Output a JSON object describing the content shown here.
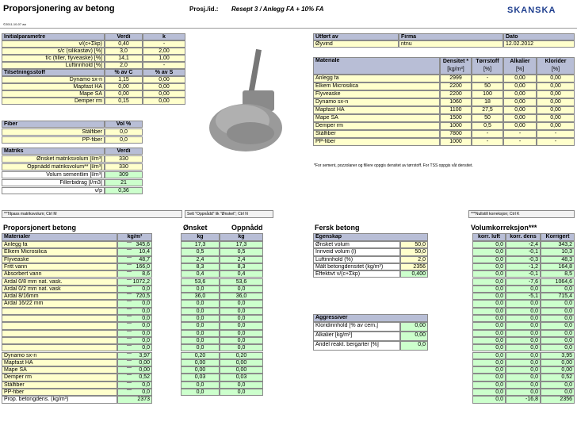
{
  "header": {
    "title": "Proporsjonering av betong",
    "proj_label": "Prosj./id.:",
    "proj_value": "Resept 3 / Anlegg FA + 10% FA",
    "brand": "SKANSKA",
    "copyright": "©2011-10-07 aa"
  },
  "initial": {
    "title": "Initialparametre",
    "col1": "Verdi",
    "col2": "k",
    "rows": [
      {
        "label": "v/(c+Σkp)",
        "val": "0,40",
        "k": "-"
      },
      {
        "label": "s/c (silikastøv) [%]",
        "val": "3,0",
        "k": "2,00"
      },
      {
        "label": "f/c (filler, flyveaske) [%]",
        "val": "14,1",
        "k": "1,00"
      },
      {
        "label": "Luftinnhold [%]",
        "val": "2,0",
        "k": "-"
      }
    ]
  },
  "additive": {
    "title": "Tilsetningsstoff",
    "col1": "% av C",
    "col2": "% av S",
    "rows": [
      {
        "label": "Dynamo sx-n",
        "c": "1,15",
        "s": "0,00"
      },
      {
        "label": "Mapfast HA",
        "c": "0,00",
        "s": "0,00"
      },
      {
        "label": "Mape SA",
        "c": "0,00",
        "s": "0,00"
      },
      {
        "label": "Demper rm",
        "c": "0,15",
        "s": "0,00"
      }
    ]
  },
  "fiber": {
    "title": "Fiber",
    "col1": "Vol %",
    "rows": [
      {
        "label": "Stålfiber",
        "val": "0,0"
      },
      {
        "label": "PP-fiber",
        "val": "0,0"
      }
    ]
  },
  "matrix": {
    "title": "Matriks",
    "col1": "Verdi",
    "rows": [
      {
        "label": "Ønsket matriksvolum [l/m³]",
        "val": "330"
      },
      {
        "label": "Oppnådd matriksvolum** [l/m³]",
        "val": "330"
      },
      {
        "label": "Volum sementlim [l/m³]",
        "val": "309"
      },
      {
        "label": "Fillerbidrag [l/m3]",
        "val": "21"
      },
      {
        "label": "v/p",
        "val": "0,36"
      }
    ]
  },
  "meta": {
    "h_by": "Utført av",
    "h_firm": "Firma",
    "h_date": "Dato",
    "by": "Øyvind",
    "firm": "ntnu",
    "date": "12.02.2012"
  },
  "materials": {
    "title": "Materiale",
    "h_density": "Densitet *",
    "h_density_unit": "[kg/m³]",
    "h_dry": "Tørrstoff",
    "h_dry_unit": "[%]",
    "h_alk": "Alkalier",
    "h_alk_unit": "[%]",
    "h_chl": "Klorider",
    "h_chl_unit": "[%]",
    "rows": [
      {
        "name": "Anlegg fa",
        "d": "2999",
        "dry": "-",
        "alk": "0,00",
        "chl": "0,00"
      },
      {
        "name": "Elkem Microsilica",
        "d": "2200",
        "dry": "50",
        "alk": "0,00",
        "chl": "0,00"
      },
      {
        "name": "Flyveaske",
        "d": "2200",
        "dry": "100",
        "alk": "0,00",
        "chl": "0,00"
      },
      {
        "name": "Dynamo sx-n",
        "d": "1060",
        "dry": "18",
        "alk": "0,00",
        "chl": "0,00"
      },
      {
        "name": "Mapfast HA",
        "d": "1100",
        "dry": "27,5",
        "alk": "0,00",
        "chl": "0,00"
      },
      {
        "name": "Mape SA",
        "d": "1500",
        "dry": "50",
        "alk": "0,00",
        "chl": "0,00"
      },
      {
        "name": "Demper rm",
        "d": "1000",
        "dry": "0,5",
        "alk": "0,00",
        "chl": "0,00"
      },
      {
        "name": "Stålfiber",
        "d": "7800",
        "dry": "-",
        "alk": "-",
        "chl": "-"
      },
      {
        "name": "PP-fiber",
        "d": "1000",
        "dry": "-",
        "alk": "-",
        "chl": "-"
      }
    ],
    "footnote": "*For sement, pozzolaner og fillere oppgis densitet av tørrstoff.   For TSS oppgis våt densitet."
  },
  "notes": {
    "left": "**Tilpass matriksvolum; Ctrl M",
    "mid": "Sett \"Oppnådd\" lik \"Ønsket\"; Ctrl N",
    "right": "***Nullstill korreksjon; Ctrl K"
  },
  "proportion": {
    "title": "Proporsjonert betong",
    "h_mat": "Materialer",
    "h_kg": "kg/m³",
    "h_wish": "Ønsket",
    "h_got": "Oppnådd",
    "unit_kg": "kg",
    "rows": [
      {
        "name": "Anlegg fa",
        "kg": "345,6",
        "w": "17,3",
        "o": "17,3"
      },
      {
        "name": "Elkem Microsilica",
        "kg": "10,4",
        "w": "0,5",
        "o": "0,5"
      },
      {
        "name": "Flyveaske",
        "kg": "48,7",
        "w": "2,4",
        "o": "2,4"
      },
      {
        "name": "Fritt vann",
        "kg": "166,0",
        "w": "8,3",
        "o": "8,3"
      },
      {
        "name": "Absorbert vann",
        "kg": "8,6",
        "w": "0,4",
        "o": "0,4"
      },
      {
        "name": "Årdal 0/8 mm nat. vask.",
        "kg": "1072,2",
        "w": "53,6",
        "o": "53,6"
      },
      {
        "name": "Årdal 0/2 mm nat. vask",
        "kg": "0,0",
        "w": "0,0",
        "o": "0,0"
      },
      {
        "name": "Årdal 8/16mm",
        "kg": "720,5",
        "w": "36,0",
        "o": "36,0"
      },
      {
        "name": "Årdal 16/22  mm",
        "kg": "0,0",
        "w": "0,0",
        "o": "0,0"
      },
      {
        "name": "",
        "kg": "0,0",
        "w": "0,0",
        "o": "0,0"
      },
      {
        "name": "",
        "kg": "0,0",
        "w": "0,0",
        "o": "0,0"
      },
      {
        "name": "",
        "kg": "0,0",
        "w": "0,0",
        "o": "0,0"
      },
      {
        "name": "",
        "kg": "0,0",
        "w": "0,0",
        "o": "0,0"
      },
      {
        "name": "",
        "kg": "0,0",
        "w": "0,0",
        "o": "0,0"
      },
      {
        "name": "",
        "kg": "0,0",
        "w": "0,0",
        "o": "0,0"
      },
      {
        "name": "Dynamo sx-n",
        "kg": "3,97",
        "w": "0,20",
        "o": "0,20"
      },
      {
        "name": "Mapfast HA",
        "kg": "0,00",
        "w": "0,00",
        "o": "0,00"
      },
      {
        "name": "Mape SA",
        "kg": "0,00",
        "w": "0,00",
        "o": "0,00"
      },
      {
        "name": "Demper rm",
        "kg": "0,52",
        "w": "0,03",
        "o": "0,03"
      },
      {
        "name": "Stålfiber",
        "kg": "0,0",
        "w": "0,0",
        "o": "0,0"
      },
      {
        "name": "PP-fiber",
        "kg": "0,0",
        "w": "0,0",
        "o": "0,0"
      },
      {
        "name": "Prop. betongdens. (kg/m³)",
        "kg": "2373",
        "w": "",
        "o": ""
      }
    ]
  },
  "fresh": {
    "title": "Fersk betong",
    "h_prop": "Egenskap",
    "rows": [
      {
        "label": "Ønsket volum",
        "val": "50,0"
      },
      {
        "label": "Innveid volum (l)",
        "val": "50,0"
      },
      {
        "label": "Luftinnhold (%)",
        "val": "2,0"
      },
      {
        "label": "Målt betongdensitet (kg/m³)",
        "val": "2356"
      },
      {
        "label": "Effektivt v/(c+Σkp)",
        "val": "0,400"
      }
    ]
  },
  "aggressive": {
    "title": "Aggressiver",
    "rows": [
      {
        "label": "Kloridinnhold [% av cem.]",
        "val": "0,00"
      },
      {
        "label": "Alkalier [kg/m³]",
        "val": "0,00"
      },
      {
        "label": "Andel reakt. bergarter [%]",
        "val": "0,0"
      }
    ]
  },
  "volume": {
    "title": "Volumkorreksjon***",
    "h_air": "korr. luft",
    "h_dens": "korr. dens",
    "h_corr": "Korrigert",
    "rows": [
      {
        "a": "0,0",
        "d": "-2,4",
        "c": "343,2"
      },
      {
        "a": "0,0",
        "d": "-0,1",
        "c": "10,3"
      },
      {
        "a": "0,0",
        "d": "-0,3",
        "c": "48,3"
      },
      {
        "a": "0,0",
        "d": "-1,2",
        "c": "164,8"
      },
      {
        "a": "0,0",
        "d": "-0,1",
        "c": "8,5"
      },
      {
        "a": "0,0",
        "d": "-7,6",
        "c": "1064,6"
      },
      {
        "a": "0,0",
        "d": "0,0",
        "c": "0,0"
      },
      {
        "a": "0,0",
        "d": "-5,1",
        "c": "715,4"
      },
      {
        "a": "0,0",
        "d": "0,0",
        "c": "0,0"
      },
      {
        "a": "0,0",
        "d": "0,0",
        "c": "0,0"
      },
      {
        "a": "0,0",
        "d": "0,0",
        "c": "0,0"
      },
      {
        "a": "0,0",
        "d": "0,0",
        "c": "0,0"
      },
      {
        "a": "0,0",
        "d": "0,0",
        "c": "0,0"
      },
      {
        "a": "0,0",
        "d": "0,0",
        "c": "0,0"
      },
      {
        "a": "0,0",
        "d": "0,0",
        "c": "0,0"
      },
      {
        "a": "0,0",
        "d": "0,0",
        "c": "3,95"
      },
      {
        "a": "0,0",
        "d": "0,0",
        "c": "0,00"
      },
      {
        "a": "0,0",
        "d": "0,0",
        "c": "0,00"
      },
      {
        "a": "0,0",
        "d": "0,0",
        "c": "0,52"
      },
      {
        "a": "0,0",
        "d": "0,0",
        "c": "0,0"
      },
      {
        "a": "0,0",
        "d": "0,0",
        "c": "0,0"
      },
      {
        "a": "0,0",
        "d": "-16,8",
        "c": "2356"
      }
    ]
  },
  "colors": {
    "input": "#ffffcc",
    "output": "#ccffcc",
    "header": "#b8bed6",
    "brand": "#1f3f8f"
  }
}
